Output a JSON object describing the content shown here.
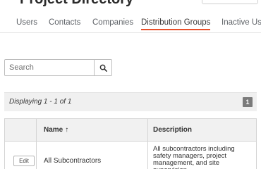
{
  "page": {
    "title": "Project Directory"
  },
  "tabs": [
    {
      "label": "Users",
      "active": false
    },
    {
      "label": "Contacts",
      "active": false
    },
    {
      "label": "Companies",
      "active": false
    },
    {
      "label": "Distribution Groups",
      "active": true
    },
    {
      "label": "Inactive Use",
      "active": false
    }
  ],
  "search": {
    "placeholder": "Search",
    "value": "",
    "button_icon": "search-icon"
  },
  "results": {
    "display_text": "Displaying 1 - 1 of 1",
    "page_number": "1"
  },
  "table": {
    "columns": [
      {
        "label": "",
        "key": "action"
      },
      {
        "label": "Name",
        "key": "name",
        "sort_indicator": "↑"
      },
      {
        "label": "Description",
        "key": "description"
      }
    ],
    "rows": [
      {
        "action_label": "Edit",
        "name": "All Subcontractors",
        "description": "All subcontractors including safety managers, project management, and site supervision"
      }
    ]
  },
  "colors": {
    "accent": "#e8502a",
    "header_bg": "#f1f1f1",
    "badge_bg": "#7b7b7b"
  }
}
